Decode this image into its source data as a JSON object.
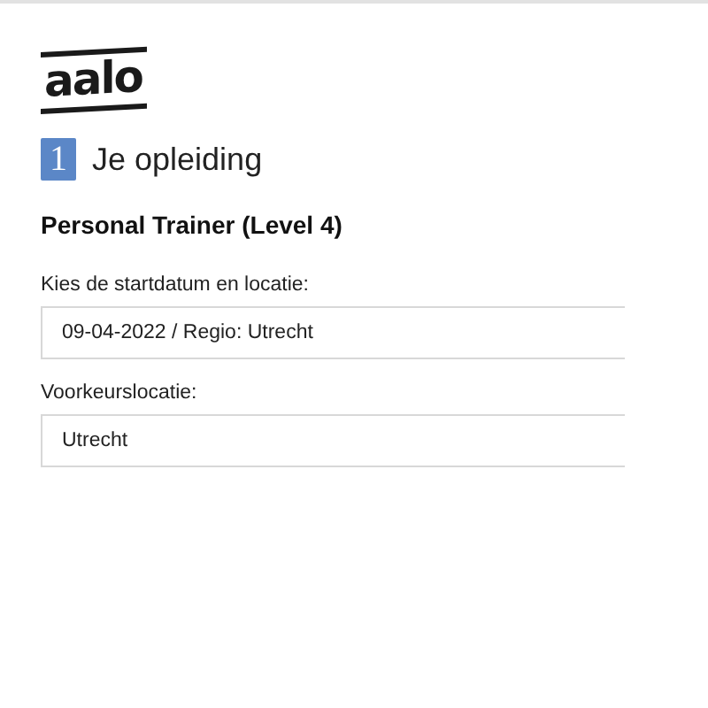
{
  "logo": "aalo",
  "step": {
    "number": "1",
    "title": "Je opleiding"
  },
  "course": "Personal Trainer (Level 4)",
  "fields": [
    {
      "label": "Kies de startdatum en locatie:",
      "value": "09-04-2022 / Regio: Utrecht"
    },
    {
      "label": "Voorkeurslocatie:",
      "value": "Utrecht"
    }
  ]
}
